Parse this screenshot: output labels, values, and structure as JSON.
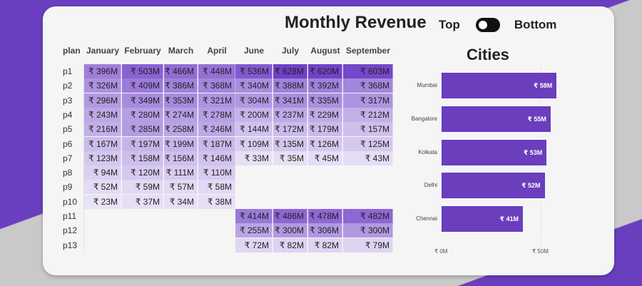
{
  "title": "Monthly Revenue",
  "toggle": {
    "left_label": "Top",
    "right_label": "Bottom"
  },
  "matrix": {
    "row_header": "plan",
    "columns": [
      "January",
      "February",
      "March",
      "April",
      "June",
      "July",
      "August",
      "September"
    ],
    "rows": [
      {
        "plan": "p1",
        "values": [
          "₹ 396M",
          "₹ 503M",
          "₹ 466M",
          "₹ 448M",
          "₹ 536M",
          "₹ 628M",
          "₹ 620M",
          "₹ 603M"
        ]
      },
      {
        "plan": "p2",
        "values": [
          "₹ 326M",
          "₹ 409M",
          "₹ 386M",
          "₹ 368M",
          "₹ 340M",
          "₹ 388M",
          "₹ 392M",
          "₹ 368M"
        ]
      },
      {
        "plan": "p3",
        "values": [
          "₹ 296M",
          "₹ 349M",
          "₹ 353M",
          "₹ 321M",
          "₹ 304M",
          "₹ 341M",
          "₹ 335M",
          "₹ 317M"
        ]
      },
      {
        "plan": "p4",
        "values": [
          "₹ 243M",
          "₹ 280M",
          "₹ 274M",
          "₹ 278M",
          "₹ 200M",
          "₹ 237M",
          "₹ 229M",
          "₹ 212M"
        ]
      },
      {
        "plan": "p5",
        "values": [
          "₹ 216M",
          "₹ 285M",
          "₹ 258M",
          "₹ 246M",
          "₹ 144M",
          "₹ 172M",
          "₹ 179M",
          "₹ 157M"
        ]
      },
      {
        "plan": "p6",
        "values": [
          "₹ 167M",
          "₹ 197M",
          "₹ 199M",
          "₹ 187M",
          "₹ 109M",
          "₹ 135M",
          "₹ 126M",
          "₹ 125M"
        ]
      },
      {
        "plan": "p7",
        "values": [
          "₹ 123M",
          "₹ 158M",
          "₹ 156M",
          "₹ 146M",
          "₹ 33M",
          "₹ 35M",
          "₹ 45M",
          "₹ 43M"
        ]
      },
      {
        "plan": "p8",
        "values": [
          "₹ 94M",
          "₹ 120M",
          "₹ 111M",
          "₹ 110M",
          "",
          "",
          "",
          ""
        ]
      },
      {
        "plan": "p9",
        "values": [
          "₹ 52M",
          "₹ 59M",
          "₹ 57M",
          "₹ 58M",
          "",
          "",
          "",
          ""
        ]
      },
      {
        "plan": "p10",
        "values": [
          "₹ 23M",
          "₹ 37M",
          "₹ 34M",
          "₹ 38M",
          "",
          "",
          "",
          ""
        ]
      },
      {
        "plan": "p11",
        "values": [
          "",
          "",
          "",
          "",
          "₹ 414M",
          "₹ 486M",
          "₹ 478M",
          "₹ 482M"
        ]
      },
      {
        "plan": "p12",
        "values": [
          "",
          "",
          "",
          "",
          "₹ 255M",
          "₹ 300M",
          "₹ 306M",
          "₹ 300M"
        ]
      },
      {
        "plan": "p13",
        "values": [
          "",
          "",
          "",
          "",
          "₹ 72M",
          "₹ 82M",
          "₹ 82M",
          "₹ 79M"
        ]
      }
    ]
  },
  "cities": {
    "title": "Cities",
    "chart_data": {
      "type": "bar",
      "orientation": "horizontal",
      "categories": [
        "Mumbai",
        "Bangalore",
        "Kolkata",
        "Delhi",
        "Chennai"
      ],
      "values": [
        58,
        55,
        53,
        52,
        41
      ],
      "value_labels": [
        "₹ 58M",
        "₹ 55M",
        "₹ 53M",
        "₹ 52M",
        "₹ 41M"
      ],
      "xlim": [
        0,
        60
      ],
      "x_ticks": [
        "₹ 0M",
        "₹ 50M"
      ],
      "grid": true
    }
  }
}
